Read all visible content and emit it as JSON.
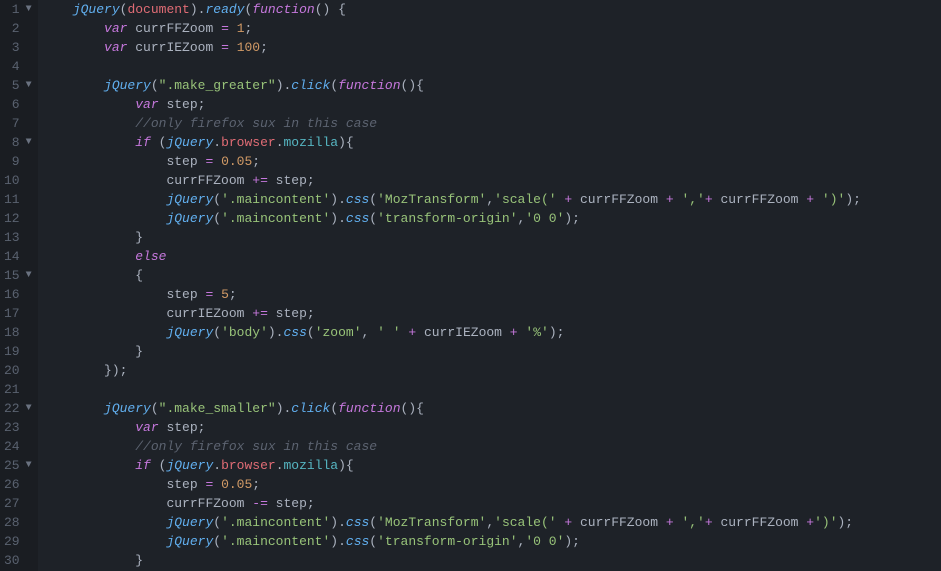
{
  "gutter": [
    {
      "n": "1",
      "fold": true
    },
    {
      "n": "2",
      "fold": false
    },
    {
      "n": "3",
      "fold": false
    },
    {
      "n": "4",
      "fold": false
    },
    {
      "n": "5",
      "fold": true
    },
    {
      "n": "6",
      "fold": false
    },
    {
      "n": "7",
      "fold": false
    },
    {
      "n": "8",
      "fold": true
    },
    {
      "n": "9",
      "fold": false
    },
    {
      "n": "10",
      "fold": false
    },
    {
      "n": "11",
      "fold": false
    },
    {
      "n": "12",
      "fold": false
    },
    {
      "n": "13",
      "fold": false
    },
    {
      "n": "14",
      "fold": false
    },
    {
      "n": "15",
      "fold": true
    },
    {
      "n": "16",
      "fold": false
    },
    {
      "n": "17",
      "fold": false
    },
    {
      "n": "18",
      "fold": false
    },
    {
      "n": "19",
      "fold": false
    },
    {
      "n": "20",
      "fold": false
    },
    {
      "n": "21",
      "fold": false
    },
    {
      "n": "22",
      "fold": true
    },
    {
      "n": "23",
      "fold": false
    },
    {
      "n": "24",
      "fold": false
    },
    {
      "n": "25",
      "fold": true
    },
    {
      "n": "26",
      "fold": false
    },
    {
      "n": "27",
      "fold": false
    },
    {
      "n": "28",
      "fold": false
    },
    {
      "n": "29",
      "fold": false
    },
    {
      "n": "30",
      "fold": false
    }
  ],
  "lines": {
    "l1": {
      "indent": "    ",
      "t": [
        [
          "fn",
          "jQuery"
        ],
        [
          "pn",
          "("
        ],
        [
          "prop",
          "document"
        ],
        [
          "pn",
          ")."
        ],
        [
          "fn",
          "ready"
        ],
        [
          "pn",
          "("
        ],
        [
          "kw",
          "function"
        ],
        [
          "pn",
          "() {"
        ]
      ]
    },
    "l2": {
      "indent": "        ",
      "t": [
        [
          "kw",
          "var"
        ],
        [
          "id",
          " currFFZoom "
        ],
        [
          "op",
          "="
        ],
        [
          "id",
          " "
        ],
        [
          "num",
          "1"
        ],
        [
          "pn",
          ";"
        ]
      ]
    },
    "l3": {
      "indent": "        ",
      "t": [
        [
          "kw",
          "var"
        ],
        [
          "id",
          " currIEZoom "
        ],
        [
          "op",
          "="
        ],
        [
          "id",
          " "
        ],
        [
          "num",
          "100"
        ],
        [
          "pn",
          ";"
        ]
      ]
    },
    "l4": {
      "indent": "",
      "t": []
    },
    "l5": {
      "indent": "        ",
      "t": [
        [
          "fn",
          "jQuery"
        ],
        [
          "pn",
          "("
        ],
        [
          "str",
          "\".make_greater\""
        ],
        [
          "pn",
          ")."
        ],
        [
          "fn",
          "click"
        ],
        [
          "pn",
          "("
        ],
        [
          "kw",
          "function"
        ],
        [
          "pn",
          "(){"
        ]
      ]
    },
    "l6": {
      "indent": "            ",
      "t": [
        [
          "kw",
          "var"
        ],
        [
          "id",
          " step"
        ],
        [
          "pn",
          ";"
        ]
      ]
    },
    "l7": {
      "indent": "            ",
      "t": [
        [
          "cm",
          "//only firefox sux in this case"
        ]
      ]
    },
    "l8": {
      "indent": "            ",
      "t": [
        [
          "kw",
          "if"
        ],
        [
          "pn",
          " ("
        ],
        [
          "fn",
          "jQuery"
        ],
        [
          "pn",
          "."
        ],
        [
          "prop",
          "browser"
        ],
        [
          "pn",
          "."
        ],
        [
          "mozilla",
          "mozilla"
        ],
        [
          "pn",
          "){"
        ]
      ]
    },
    "l9": {
      "indent": "                ",
      "t": [
        [
          "id",
          "step "
        ],
        [
          "op",
          "="
        ],
        [
          "id",
          " "
        ],
        [
          "num",
          "0.05"
        ],
        [
          "pn",
          ";"
        ]
      ]
    },
    "l10": {
      "indent": "                ",
      "t": [
        [
          "id",
          "currFFZoom "
        ],
        [
          "op",
          "+="
        ],
        [
          "id",
          " step"
        ],
        [
          "pn",
          ";"
        ]
      ]
    },
    "l11": {
      "indent": "                ",
      "t": [
        [
          "fn",
          "jQuery"
        ],
        [
          "pn",
          "("
        ],
        [
          "str",
          "'.maincontent'"
        ],
        [
          "pn",
          ")."
        ],
        [
          "fn",
          "css"
        ],
        [
          "pn",
          "("
        ],
        [
          "str",
          "'MozTransform'"
        ],
        [
          "pn",
          ","
        ],
        [
          "str",
          "'scale('"
        ],
        [
          "pn",
          " "
        ],
        [
          "op",
          "+"
        ],
        [
          "id",
          " currFFZoom "
        ],
        [
          "op",
          "+"
        ],
        [
          "pn",
          " "
        ],
        [
          "str",
          "','"
        ],
        [
          "op",
          "+"
        ],
        [
          "id",
          " currFFZoom "
        ],
        [
          "op",
          "+"
        ],
        [
          "pn",
          " "
        ],
        [
          "str",
          "')'"
        ],
        [
          "pn",
          ");"
        ]
      ]
    },
    "l12": {
      "indent": "                ",
      "t": [
        [
          "fn",
          "jQuery"
        ],
        [
          "pn",
          "("
        ],
        [
          "str",
          "'.maincontent'"
        ],
        [
          "pn",
          ")."
        ],
        [
          "fn",
          "css"
        ],
        [
          "pn",
          "("
        ],
        [
          "str",
          "'transform-origin'"
        ],
        [
          "pn",
          ","
        ],
        [
          "str",
          "'0 0'"
        ],
        [
          "pn",
          ");"
        ]
      ]
    },
    "l13": {
      "indent": "            ",
      "t": [
        [
          "pn",
          "}"
        ]
      ]
    },
    "l14": {
      "indent": "            ",
      "t": [
        [
          "kw",
          "else"
        ]
      ]
    },
    "l15": {
      "indent": "            ",
      "t": [
        [
          "pn",
          "{"
        ]
      ]
    },
    "l16": {
      "indent": "                ",
      "t": [
        [
          "id",
          "step "
        ],
        [
          "op",
          "="
        ],
        [
          "id",
          " "
        ],
        [
          "num",
          "5"
        ],
        [
          "pn",
          ";"
        ]
      ]
    },
    "l17": {
      "indent": "                ",
      "t": [
        [
          "id",
          "currIEZoom "
        ],
        [
          "op",
          "+="
        ],
        [
          "id",
          " step"
        ],
        [
          "pn",
          ";"
        ]
      ]
    },
    "l18": {
      "indent": "                ",
      "t": [
        [
          "fn",
          "jQuery"
        ],
        [
          "pn",
          "("
        ],
        [
          "str",
          "'body'"
        ],
        [
          "pn",
          ")."
        ],
        [
          "fn",
          "css"
        ],
        [
          "pn",
          "("
        ],
        [
          "str",
          "'zoom'"
        ],
        [
          "pn",
          ", "
        ],
        [
          "str",
          "' '"
        ],
        [
          "pn",
          " "
        ],
        [
          "op",
          "+"
        ],
        [
          "id",
          " currIEZoom "
        ],
        [
          "op",
          "+"
        ],
        [
          "pn",
          " "
        ],
        [
          "str",
          "'%'"
        ],
        [
          "pn",
          ");"
        ]
      ]
    },
    "l19": {
      "indent": "            ",
      "t": [
        [
          "pn",
          "}"
        ]
      ]
    },
    "l20": {
      "indent": "        ",
      "t": [
        [
          "pn",
          "});"
        ]
      ]
    },
    "l21": {
      "indent": "",
      "t": []
    },
    "l22": {
      "indent": "        ",
      "t": [
        [
          "fn",
          "jQuery"
        ],
        [
          "pn",
          "("
        ],
        [
          "str",
          "\".make_smaller\""
        ],
        [
          "pn",
          ")."
        ],
        [
          "fn",
          "click"
        ],
        [
          "pn",
          "("
        ],
        [
          "kw",
          "function"
        ],
        [
          "pn",
          "(){"
        ]
      ]
    },
    "l23": {
      "indent": "            ",
      "t": [
        [
          "kw",
          "var"
        ],
        [
          "id",
          " step"
        ],
        [
          "pn",
          ";"
        ]
      ]
    },
    "l24": {
      "indent": "            ",
      "t": [
        [
          "cm",
          "//only firefox sux in this case"
        ]
      ]
    },
    "l25": {
      "indent": "            ",
      "t": [
        [
          "kw",
          "if"
        ],
        [
          "pn",
          " ("
        ],
        [
          "fn",
          "jQuery"
        ],
        [
          "pn",
          "."
        ],
        [
          "prop",
          "browser"
        ],
        [
          "pn",
          "."
        ],
        [
          "mozilla",
          "mozilla"
        ],
        [
          "pn",
          "){"
        ]
      ]
    },
    "l26": {
      "indent": "                ",
      "t": [
        [
          "id",
          "step "
        ],
        [
          "op",
          "="
        ],
        [
          "id",
          " "
        ],
        [
          "num",
          "0.05"
        ],
        [
          "pn",
          ";"
        ]
      ]
    },
    "l27": {
      "indent": "                ",
      "t": [
        [
          "id",
          "currFFZoom "
        ],
        [
          "op",
          "-="
        ],
        [
          "id",
          " step"
        ],
        [
          "pn",
          ";"
        ]
      ]
    },
    "l28": {
      "indent": "                ",
      "t": [
        [
          "fn",
          "jQuery"
        ],
        [
          "pn",
          "("
        ],
        [
          "str",
          "'.maincontent'"
        ],
        [
          "pn",
          ")."
        ],
        [
          "fn",
          "css"
        ],
        [
          "pn",
          "("
        ],
        [
          "str",
          "'MozTransform'"
        ],
        [
          "pn",
          ","
        ],
        [
          "str",
          "'scale('"
        ],
        [
          "pn",
          " "
        ],
        [
          "op",
          "+"
        ],
        [
          "id",
          " currFFZoom "
        ],
        [
          "op",
          "+"
        ],
        [
          "pn",
          " "
        ],
        [
          "str",
          "','"
        ],
        [
          "op",
          "+"
        ],
        [
          "id",
          " currFFZoom "
        ],
        [
          "op",
          "+"
        ],
        [
          "str",
          "')'"
        ],
        [
          "pn",
          ");"
        ]
      ]
    },
    "l29": {
      "indent": "                ",
      "t": [
        [
          "fn",
          "jQuery"
        ],
        [
          "pn",
          "("
        ],
        [
          "str",
          "'.maincontent'"
        ],
        [
          "pn",
          ")."
        ],
        [
          "fn",
          "css"
        ],
        [
          "pn",
          "("
        ],
        [
          "str",
          "'transform-origin'"
        ],
        [
          "pn",
          ","
        ],
        [
          "str",
          "'0 0'"
        ],
        [
          "pn",
          ");"
        ]
      ]
    },
    "l30": {
      "indent": "            ",
      "t": [
        [
          "pn",
          "}"
        ]
      ]
    }
  }
}
